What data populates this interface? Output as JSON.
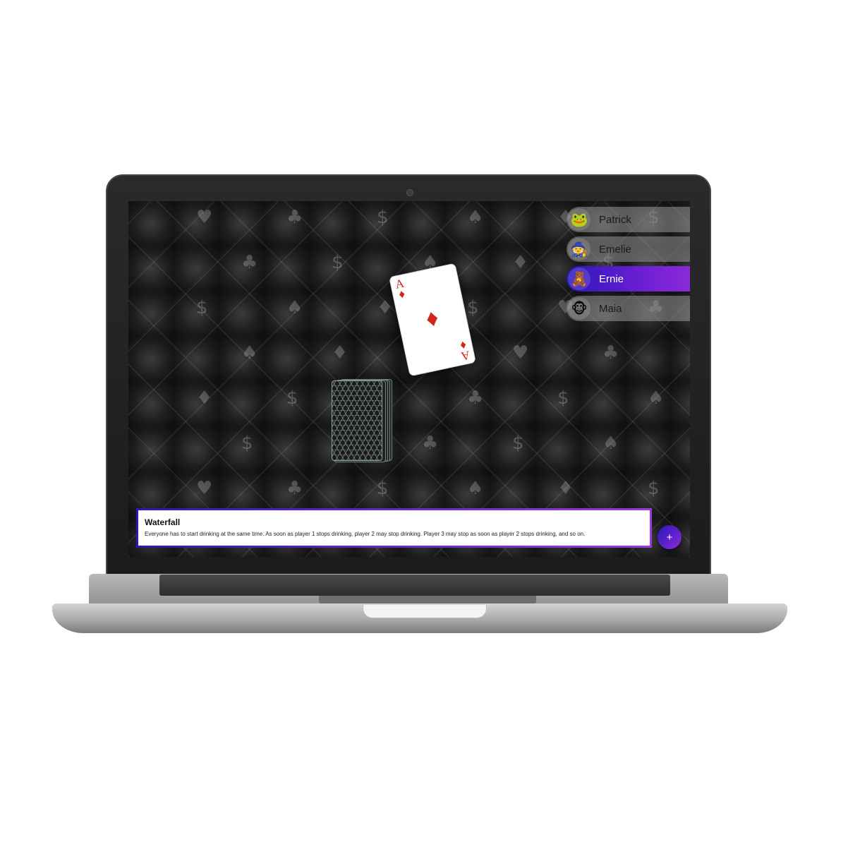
{
  "players": [
    {
      "name": "Patrick",
      "avatar_icon": "frog-icon",
      "avatar_glyph": "🐸",
      "active": false
    },
    {
      "name": "Emelie",
      "avatar_icon": "gnome-icon",
      "avatar_glyph": "🧙",
      "active": false
    },
    {
      "name": "Ernie",
      "avatar_icon": "bear-icon",
      "avatar_glyph": "🧸",
      "active": true
    },
    {
      "name": "Maia",
      "avatar_icon": "monkey-icon",
      "avatar_glyph": "🐵",
      "active": false
    }
  ],
  "drawn_card": {
    "rank": "A",
    "suit_symbol": "♦",
    "suit_color": "#d0271a"
  },
  "rule": {
    "title": "Waterfall",
    "description": "Everyone has to start drinking at the same time. As soon as player 1 stops drinking, player 2 may stop drinking. Player 3 may stop as soon as player 2 stops drinking, and so on."
  },
  "add_button": {
    "label": "+",
    "icon": "plus-icon"
  },
  "colors": {
    "accent_start": "#2a17b8",
    "accent_end": "#8b2ad8",
    "card_red": "#d0271a"
  }
}
